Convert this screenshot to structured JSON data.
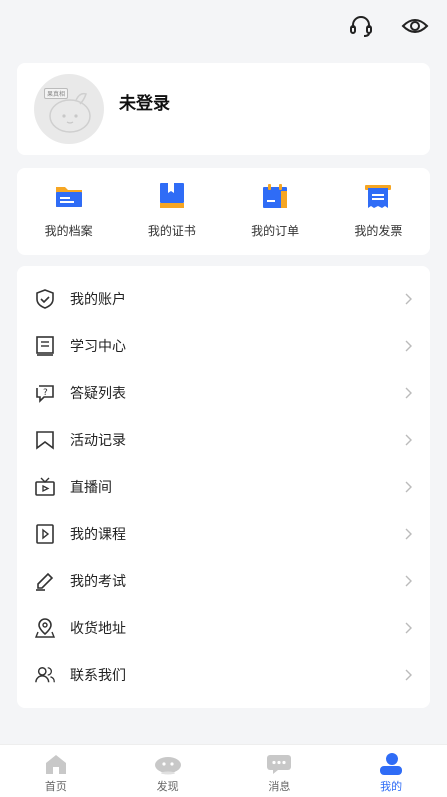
{
  "header": {
    "icons": [
      "headset-icon",
      "eye-icon"
    ]
  },
  "profile": {
    "avatar_tag": "果真相",
    "username": "未登录"
  },
  "quick_links": [
    {
      "label": "我的档案",
      "icon": "folder-icon"
    },
    {
      "label": "我的证书",
      "icon": "certificate-icon"
    },
    {
      "label": "我的订单",
      "icon": "order-icon"
    },
    {
      "label": "我的发票",
      "icon": "invoice-icon"
    }
  ],
  "menu": [
    {
      "label": "我的账户",
      "icon": "shield-icon"
    },
    {
      "label": "学习中心",
      "icon": "book-icon"
    },
    {
      "label": "答疑列表",
      "icon": "question-chat-icon"
    },
    {
      "label": "活动记录",
      "icon": "bookmark-icon"
    },
    {
      "label": "直播间",
      "icon": "tv-icon"
    },
    {
      "label": "我的课程",
      "icon": "play-file-icon"
    },
    {
      "label": "我的考试",
      "icon": "pencil-icon"
    },
    {
      "label": "收货地址",
      "icon": "location-icon"
    },
    {
      "label": "联系我们",
      "icon": "contacts-icon"
    }
  ],
  "tabs": [
    {
      "label": "首页",
      "icon": "home-icon",
      "active": false
    },
    {
      "label": "发现",
      "icon": "discover-icon",
      "active": false
    },
    {
      "label": "消息",
      "icon": "message-icon",
      "active": false
    },
    {
      "label": "我的",
      "icon": "user-icon",
      "active": true
    }
  ],
  "colors": {
    "accent": "#2f6cf6",
    "orange": "#f6a623",
    "inactive_tab": "#c8c8c8"
  }
}
